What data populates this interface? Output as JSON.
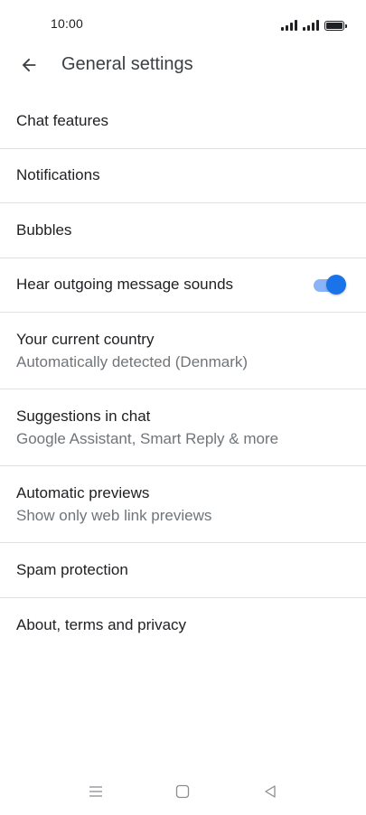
{
  "status_bar": {
    "time": "10:00"
  },
  "app_bar": {
    "title": "General settings",
    "back_icon": "arrow-left-icon"
  },
  "settings": [
    {
      "title": "Chat features",
      "subtitle": ""
    },
    {
      "title": "Notifications",
      "subtitle": ""
    },
    {
      "title": "Bubbles",
      "subtitle": ""
    },
    {
      "title": "Hear outgoing message sounds",
      "subtitle": "",
      "toggle_on": true
    },
    {
      "title": "Your current country",
      "subtitle": "Automatically detected (Denmark)"
    },
    {
      "title": "Suggestions in chat",
      "subtitle": "Google Assistant, Smart Reply & more"
    },
    {
      "title": "Automatic previews",
      "subtitle": "Show only web link previews"
    },
    {
      "title": "Spam protection",
      "subtitle": ""
    },
    {
      "title": "About, terms and privacy",
      "subtitle": ""
    }
  ],
  "colors": {
    "toggle_thumb": "#1a73e8",
    "toggle_track": "#8ab4f8",
    "divider": "#e0e0e0",
    "subtitle": "#70757a"
  },
  "nav_bar": {
    "menu_icon": "menu-icon",
    "home_icon": "home-square-icon",
    "back_icon": "back-triangle-icon"
  }
}
